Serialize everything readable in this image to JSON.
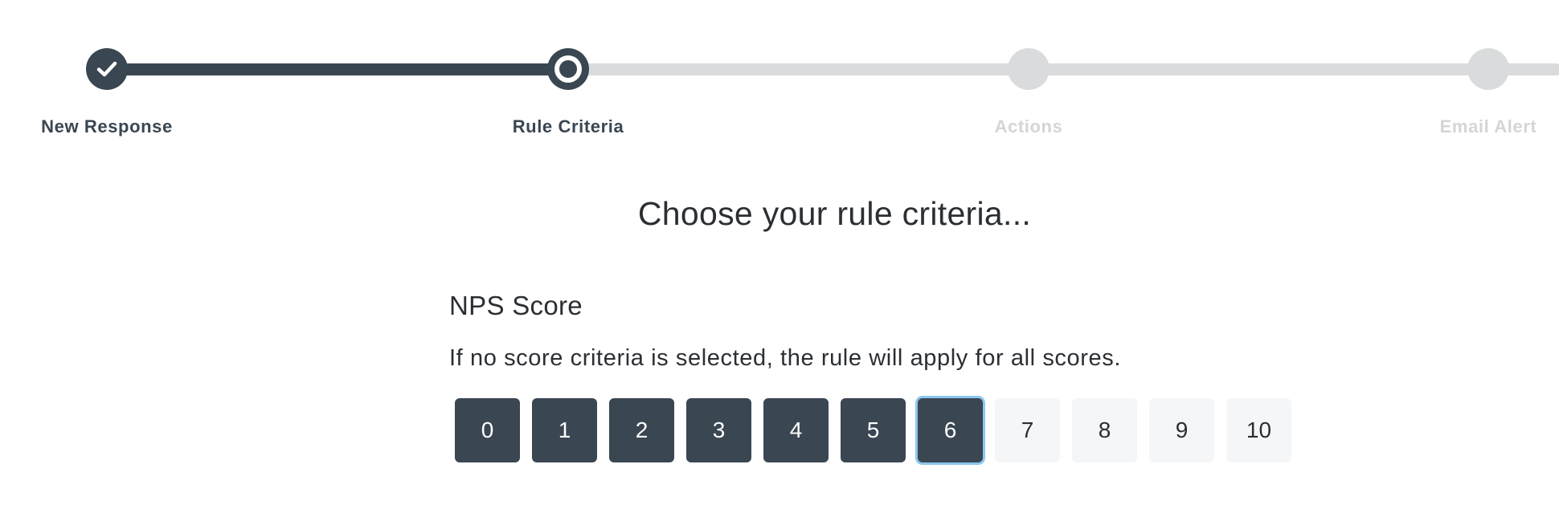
{
  "stepper": {
    "steps": [
      {
        "label": "New Response",
        "state": "done"
      },
      {
        "label": "Rule Criteria",
        "state": "current"
      },
      {
        "label": "Actions",
        "state": "todo"
      },
      {
        "label": "Email Alert",
        "state": "todo"
      }
    ]
  },
  "page": {
    "heading": "Choose your rule criteria..."
  },
  "nps": {
    "title": "NPS Score",
    "help_text": "If no score criteria is selected, the rule will apply for all scores.",
    "scores": [
      "0",
      "1",
      "2",
      "3",
      "4",
      "5",
      "6",
      "7",
      "8",
      "9",
      "10"
    ],
    "selected": [
      "0",
      "1",
      "2",
      "3",
      "4",
      "5",
      "6"
    ],
    "focused": "6"
  },
  "colors": {
    "primary": "#3a4652",
    "inactive": "#dadbdc",
    "focus_ring": "#8cc7ee",
    "chip_background": "#f5f6f7"
  }
}
